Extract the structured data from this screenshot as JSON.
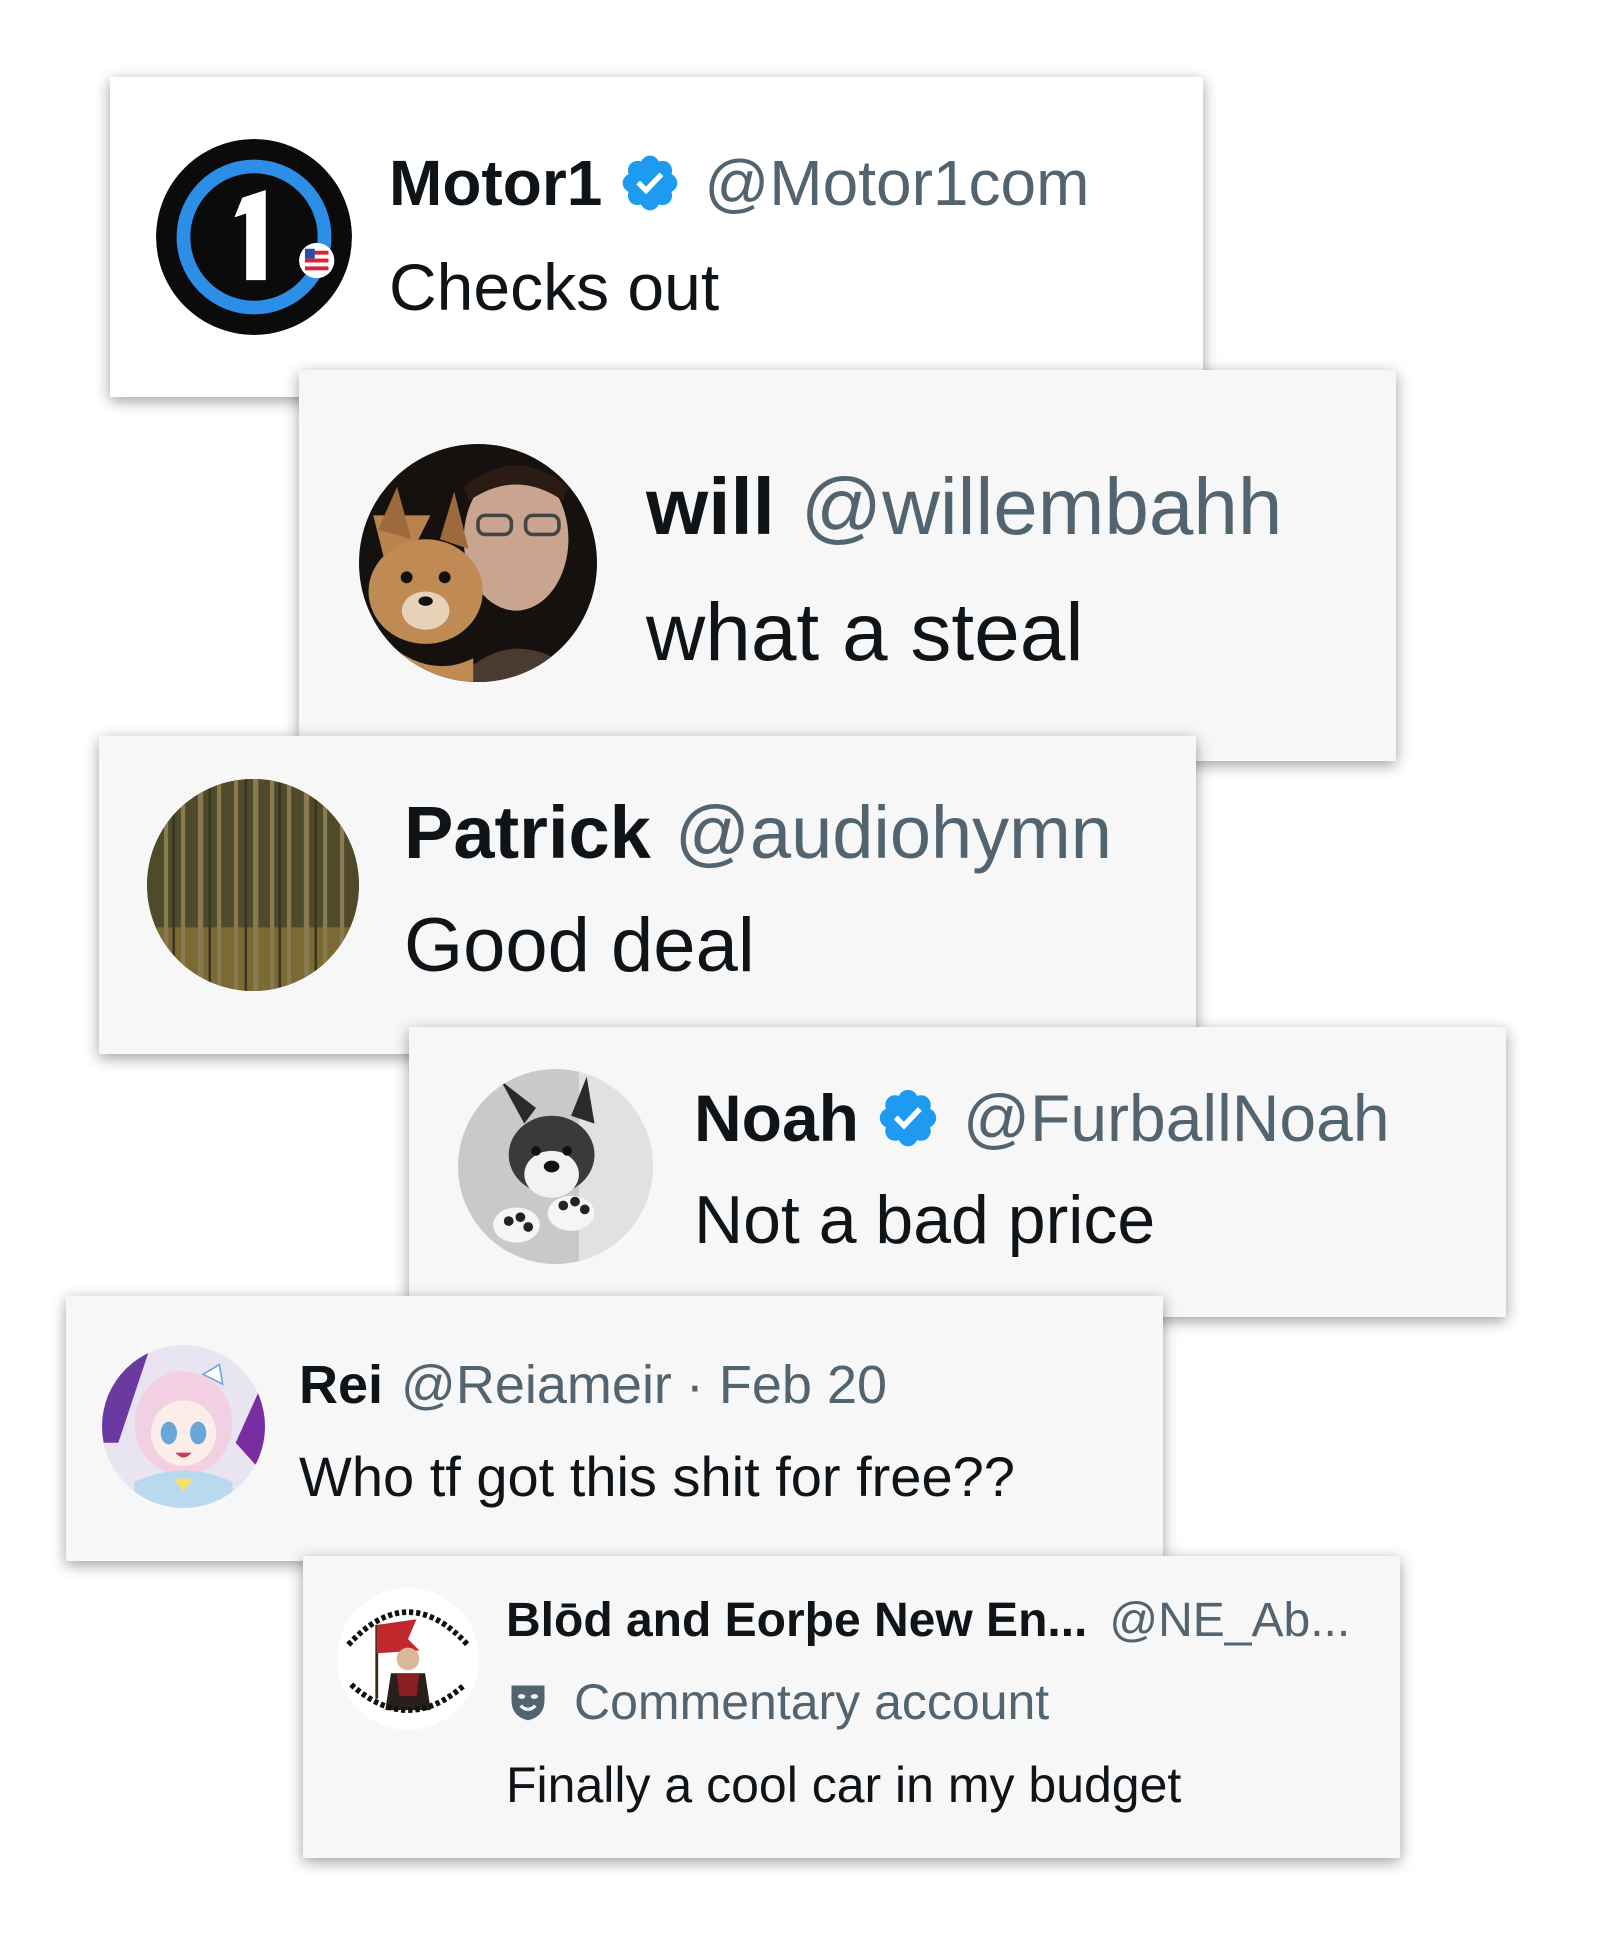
{
  "replies": [
    {
      "name": "Motor1",
      "handle": "@Motor1com",
      "text": "Checks out",
      "verified": true,
      "avatar": "motor1-logo"
    },
    {
      "name": "will",
      "handle": "@willembahh",
      "text": "what a steal",
      "verified": false,
      "avatar": "dog-and-man-photo"
    },
    {
      "name": "Patrick",
      "handle": "@audiohymn",
      "text": "Good deal",
      "verified": false,
      "avatar": "forest-painting"
    },
    {
      "name": "Noah",
      "handle": "@FurballNoah",
      "text": "Not a bad price",
      "verified": true,
      "avatar": "fursuit-photo"
    },
    {
      "name": "Rei",
      "handle": "@Reiameir",
      "date": "· Feb 20",
      "text": "Who tf got this shit for free??",
      "verified": false,
      "avatar": "anime-avatar"
    },
    {
      "name": "Blōd and Eorþe New En...",
      "handle": "@NE_Ab...",
      "label": "Commentary account",
      "text": "Finally a cool car in my budget",
      "verified": false,
      "avatar": "flag-bearer-badge"
    }
  ],
  "colors": {
    "verified": "#1d9bf0",
    "handle": "#536471",
    "text": "#0f1419",
    "card_white": "#ffffff",
    "card_gray": "#f7f7f8"
  }
}
